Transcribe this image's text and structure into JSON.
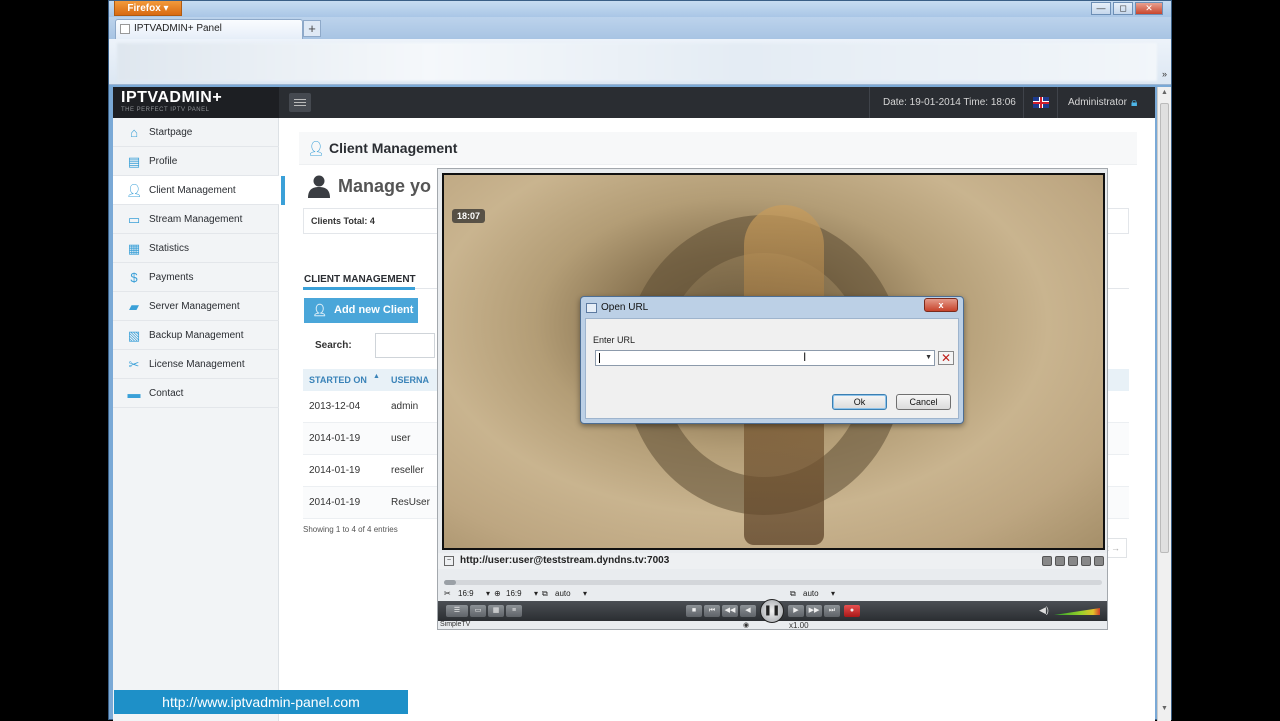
{
  "firefox": {
    "menu_button": "Firefox",
    "tab_title": "IPTVADMIN+ Panel",
    "new_tab": "+",
    "controls": {
      "minimize": "—",
      "maximize": "◻",
      "close": "✕"
    },
    "navbar_overflow": "»"
  },
  "admin": {
    "logo_title": "IPTVADMIN+",
    "logo_subtitle": "THE PERFECT IPTV PANEL",
    "datetime": "Date: 19-01-2014 Time: 18:06",
    "user": "Administrator"
  },
  "sidebar": {
    "items": [
      {
        "label": "Startpage",
        "icon": "home-icon"
      },
      {
        "label": "Profile",
        "icon": "document-icon"
      },
      {
        "label": "Client Management",
        "icon": "user-icon",
        "active": true
      },
      {
        "label": "Stream Management",
        "icon": "monitor-icon"
      },
      {
        "label": "Statistics",
        "icon": "chart-icon"
      },
      {
        "label": "Payments",
        "icon": "dollar-icon"
      },
      {
        "label": "Server Management",
        "icon": "server-icon"
      },
      {
        "label": "Backup Management",
        "icon": "backup-icon"
      },
      {
        "label": "License Management",
        "icon": "tools-icon"
      },
      {
        "label": "Contact",
        "icon": "chat-icon"
      }
    ]
  },
  "main": {
    "page_title": "Client Management",
    "manage_title": "Manage yo",
    "clients_total": "Clients Total: 4",
    "section_heading": "CLIENT MANAGEMENT",
    "add_button": "Add new Client",
    "search_label": "Search:",
    "table": {
      "headers": [
        "STARTED ON",
        "USERNA"
      ],
      "rows": [
        [
          "2013-12-04",
          "admin"
        ],
        [
          "2014-01-19",
          "user"
        ],
        [
          "2014-01-19",
          "reseller"
        ],
        [
          "2014-01-19",
          "ResUser"
        ]
      ],
      "info": "Showing 1 to 4 of 4 entries",
      "next": "t →"
    }
  },
  "player": {
    "video_time": "18:07",
    "url": "http://user:user@teststream.dyndns.tv:7003",
    "aspect1": "16:9",
    "aspect2": "16:9",
    "option1": "auto",
    "option2": "auto",
    "speed": "x1.00",
    "brand": "SimpleTV"
  },
  "dialog": {
    "title": "Open URL",
    "close": "x",
    "label": "Enter URL",
    "input_value": "",
    "ok": "Ok",
    "cancel": "Cancel"
  },
  "banner": "http://www.iptvadmin-panel.com"
}
